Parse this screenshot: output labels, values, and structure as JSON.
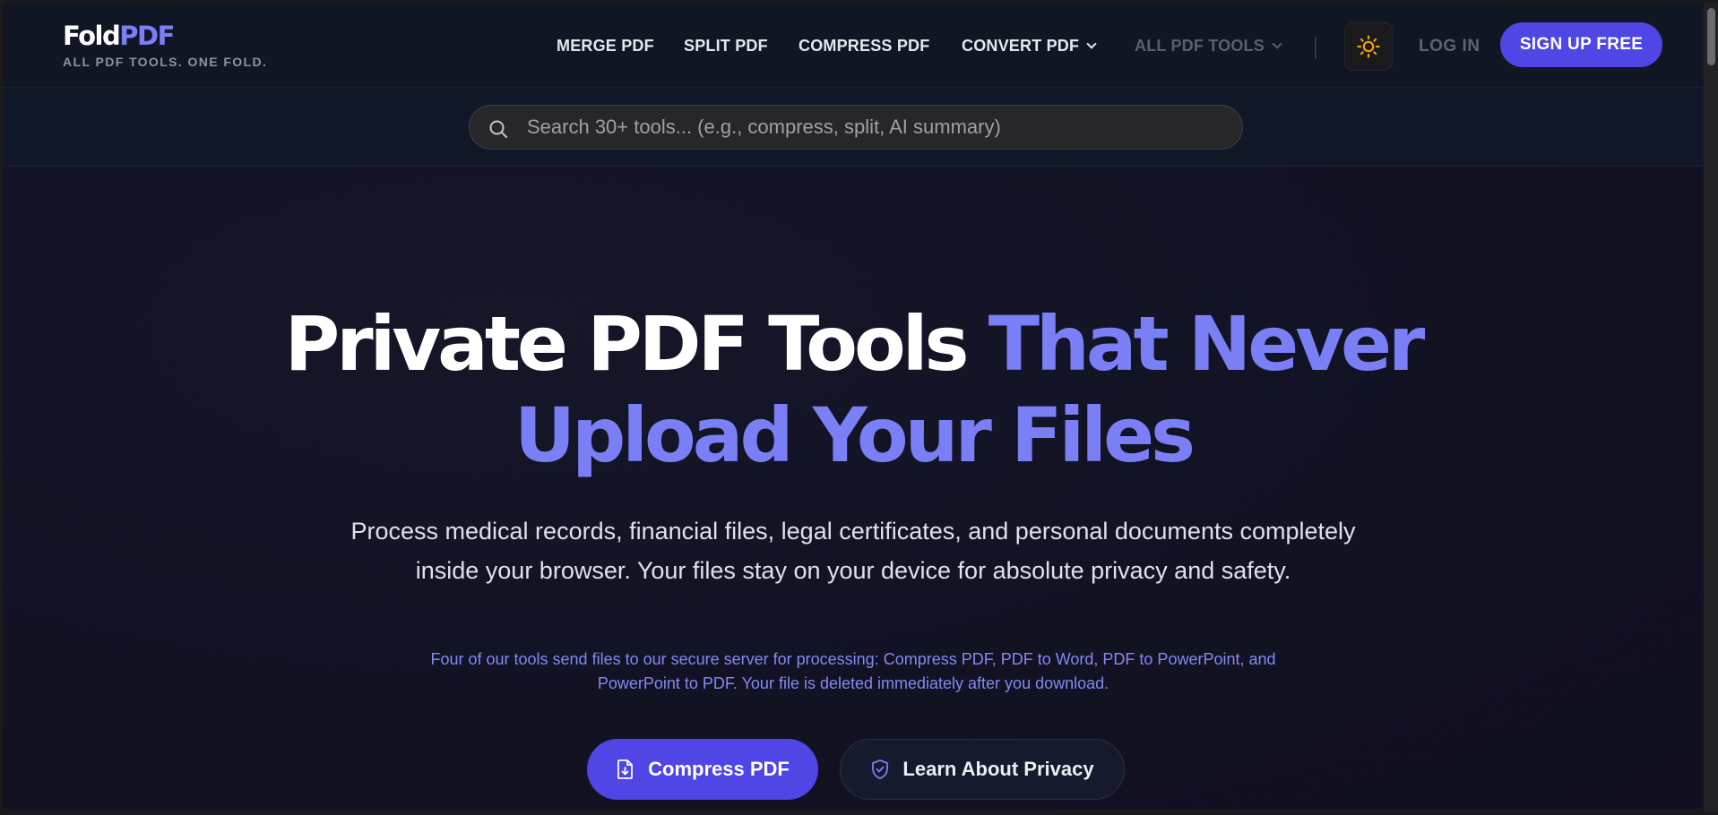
{
  "brand": {
    "logo_part1": "Fold",
    "logo_part2": "PDF",
    "tagline": "ALL PDF TOOLS. ONE FOLD."
  },
  "nav": {
    "merge": "MERGE PDF",
    "split": "SPLIT PDF",
    "compress": "COMPRESS PDF",
    "convert": "CONVERT PDF",
    "all_tools": "ALL PDF TOOLS",
    "login": "LOG IN",
    "signup": "SIGN UP FREE"
  },
  "search": {
    "placeholder": "Search 30+ tools... (e.g., compress, split, AI summary)",
    "value": ""
  },
  "hero": {
    "title_plain": "Private PDF Tools",
    "title_accent_line1": "That Never",
    "title_accent_line2": "Upload Your Files",
    "subtitle": "Process medical records, financial files, legal certificates, and personal documents completely inside your browser. Your files stay on your device for absolute privacy and safety.",
    "note": "Four of our tools send files to our secure server for processing: Compress PDF, PDF to Word, PDF to PowerPoint, and PowerPoint to PDF. Your file is deleted immediately after you download.",
    "primary_button": "Compress PDF",
    "secondary_button": "Learn About Privacy"
  },
  "icons": {
    "search": "search-icon",
    "theme": "sun-icon",
    "convert_dropdown": "chevron-down-icon",
    "all_tools_dropdown": "chevron-down-icon",
    "primary_button": "file-download-icon",
    "secondary_button": "shield-check-icon"
  },
  "colors": {
    "accent": "#7b7ff5",
    "primary_button": "#4f46e5",
    "sun": "#f59e0b"
  }
}
